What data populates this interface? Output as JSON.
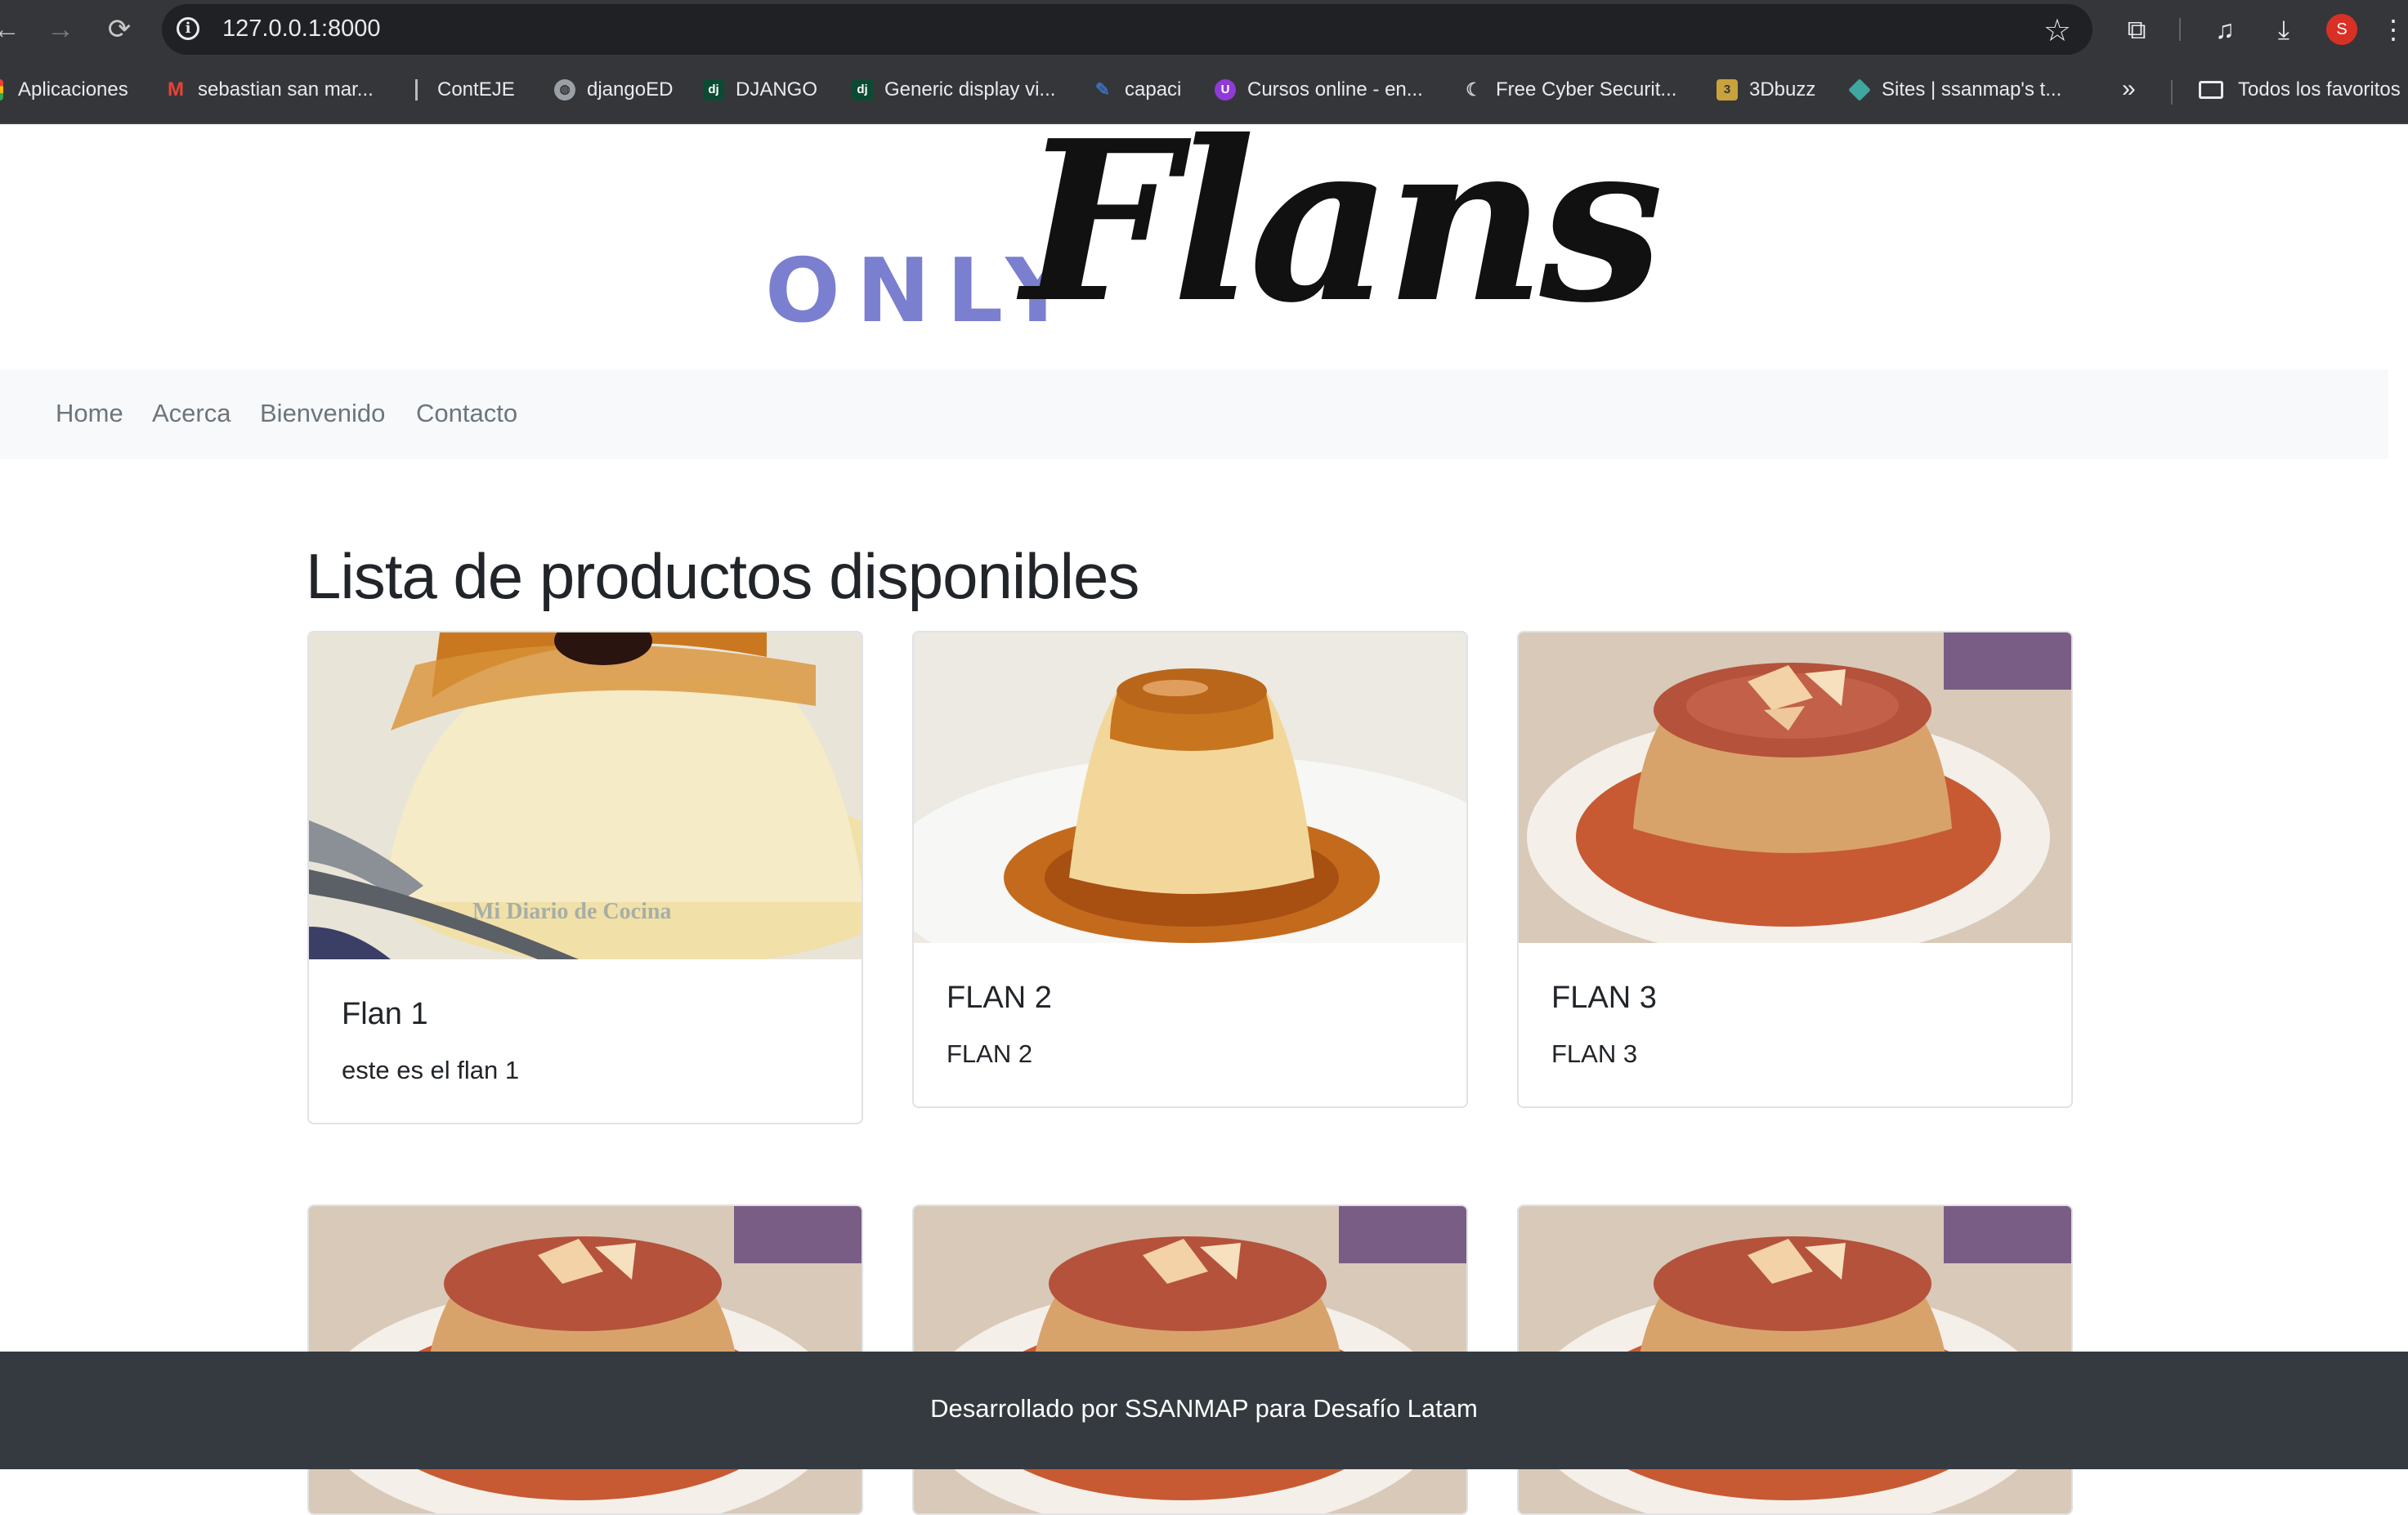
{
  "browser": {
    "url": "127.0.0.1:8000",
    "profile_initial": "S",
    "bookmarks": [
      {
        "label": "Aplicaciones",
        "icon": "apps-grid-icon"
      },
      {
        "label": "sebastian san mar...",
        "icon": "gmail-icon"
      },
      {
        "label": "ContEJE",
        "icon": "page-icon"
      },
      {
        "label": "djangoED",
        "icon": "globe-icon"
      },
      {
        "label": "DJANGO",
        "icon": "django-icon"
      },
      {
        "label": "Generic display vi...",
        "icon": "django-icon"
      },
      {
        "label": "capaci",
        "icon": "edit-icon"
      },
      {
        "label": "Cursos online - en...",
        "icon": "udemy-icon"
      },
      {
        "label": "Free Cyber Securit...",
        "icon": "moon-icon"
      },
      {
        "label": "3Dbuzz",
        "icon": "3dbuzz-icon"
      },
      {
        "label": "Sites | ssanmap's t...",
        "icon": "sites-icon"
      }
    ],
    "all_bookmarks_label": "Todos los favoritos"
  },
  "logo": {
    "only": "ONLY",
    "flans": "Flans"
  },
  "nav": {
    "items": [
      "Home",
      "Acerca",
      "Bienvenido",
      "Contacto"
    ]
  },
  "main": {
    "heading": "Lista de productos disponibles",
    "products": [
      {
        "title": "Flan 1",
        "description": "este es el flan 1",
        "image_caption": "Mi Diario de Cocina"
      },
      {
        "title": "FLAN 2",
        "description": "FLAN 2"
      },
      {
        "title": "FLAN 3",
        "description": "FLAN 3"
      },
      {
        "title": "",
        "description": ""
      },
      {
        "title": "",
        "description": ""
      },
      {
        "title": "",
        "description": ""
      }
    ]
  },
  "footer": {
    "text": "Desarrollado por SSANMAP para Desafío Latam"
  }
}
